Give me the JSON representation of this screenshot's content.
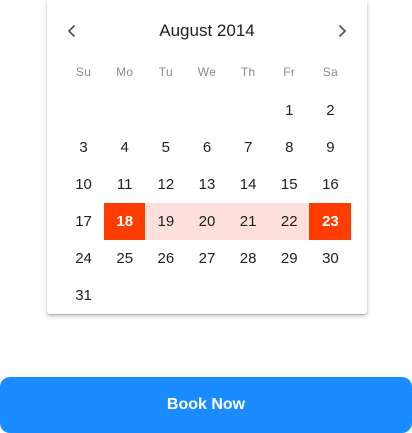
{
  "calendar": {
    "month_title": "August 2014",
    "prev_icon": "chevron-left-icon",
    "next_icon": "chevron-right-icon",
    "weekdays": [
      "Su",
      "Mo",
      "Tu",
      "We",
      "Th",
      "Fr",
      "Sa"
    ],
    "range_start_day": "18",
    "range_end_day": "23",
    "colors": {
      "range_endpoint": "#ff3d00",
      "range_fill": "#fde0dc",
      "text": "#212121",
      "weekday_text": "#8a8a8a"
    },
    "weeks": [
      [
        "",
        "",
        "",
        "",
        "",
        "1",
        "2"
      ],
      [
        "3",
        "4",
        "5",
        "6",
        "7",
        "8",
        "9"
      ],
      [
        "10",
        "11",
        "12",
        "13",
        "14",
        "15",
        "16"
      ],
      [
        "17",
        "18",
        "19",
        "20",
        "21",
        "22",
        "23"
      ],
      [
        "24",
        "25",
        "26",
        "27",
        "28",
        "29",
        "30"
      ],
      [
        "31",
        "",
        "",
        "",
        "",
        "",
        ""
      ]
    ]
  },
  "book_button": {
    "label": "Book Now",
    "color": "#1a8cff"
  }
}
